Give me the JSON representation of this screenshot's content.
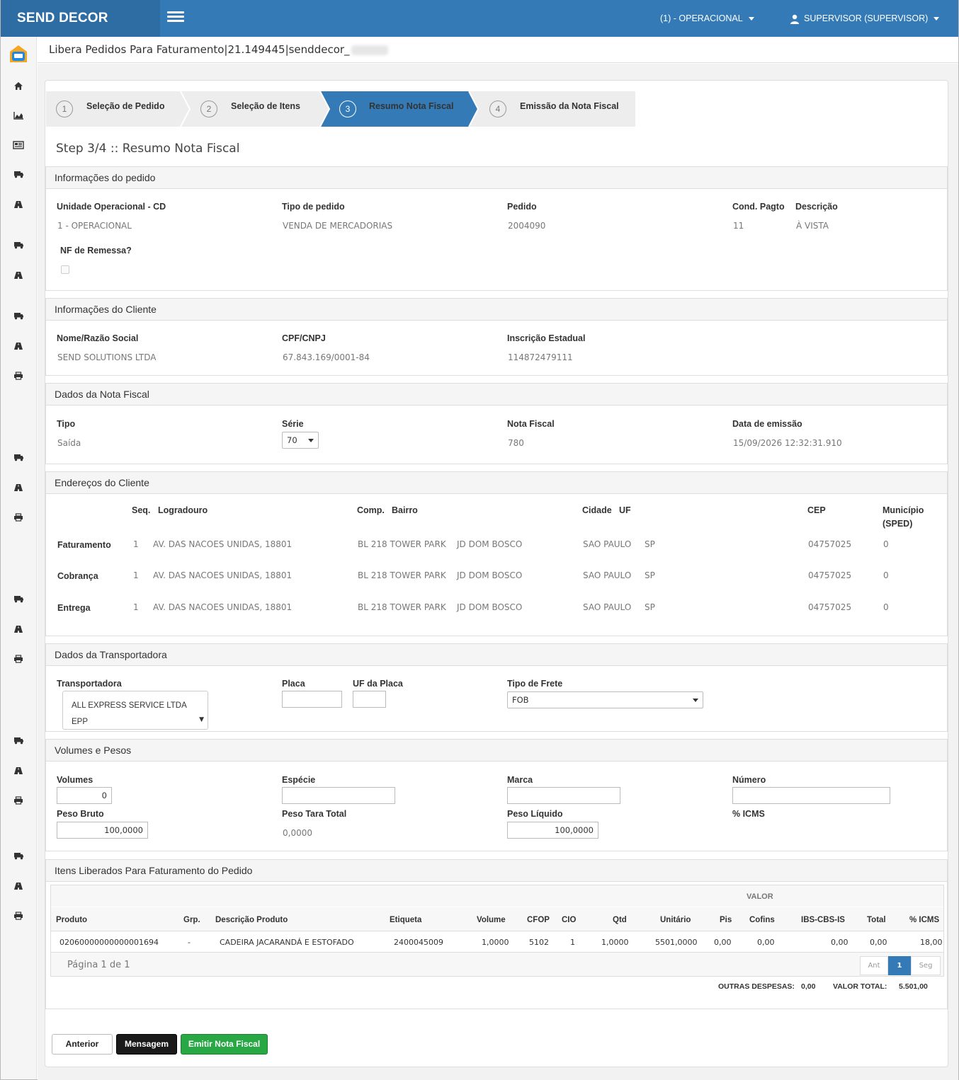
{
  "app": {
    "brand": "SEND DECOR"
  },
  "header": {
    "unit": "(1) - OPERACIONAL",
    "user": "SUPERVISOR (SUPERVISOR)"
  },
  "breadcrumb": "Libera Pedidos Para Faturamento|21.149445|senddecor_",
  "wizard": {
    "steps": [
      {
        "num": "1",
        "label": "Seleção de Pedido"
      },
      {
        "num": "2",
        "label": "Seleção de Itens"
      },
      {
        "num": "3",
        "label": "Resumo Nota Fiscal"
      },
      {
        "num": "4",
        "label": "Emissão da Nota Fiscal"
      }
    ],
    "active_step": 3,
    "active_color": "#337ab7"
  },
  "step_title": "Step 3/4 :: Resumo Nota Fiscal",
  "pedido": {
    "title": "Informações do pedido",
    "unidade_label": "Unidade Operacional - CD",
    "unidade_value": "1 - OPERACIONAL",
    "tipo_label": "Tipo de pedido",
    "tipo_value": "VENDA DE MERCADORIAS",
    "pedido_label": "Pedido",
    "pedido_value": "2004090",
    "cond_label": "Cond. Pagto",
    "cond_value": "11",
    "desc_label": "Descrição",
    "desc_value": "À VISTA",
    "remessa_label": "NF de Remessa?"
  },
  "cliente": {
    "title": "Informações do Cliente",
    "nome_label": "Nome/Razão Social",
    "nome_value": "SEND SOLUTIONS LTDA",
    "cpf_label": "CPF/CNPJ",
    "cpf_value": "67.843.169/0001-84",
    "ie_label": "Inscrição Estadual",
    "ie_value": "114872479111"
  },
  "nota": {
    "title": "Dados da Nota Fiscal",
    "tipo_label": "Tipo",
    "tipo_value": "Saída",
    "serie_label": "Série",
    "serie_value": "70",
    "nf_label": "Nota Fiscal",
    "nf_value": "780",
    "data_label": "Data de emissão",
    "data_value": "15/09/2026 12:32:31.910"
  },
  "enderecos": {
    "title": "Endereços do Cliente",
    "headers": {
      "seq": "Seq.",
      "logradouro": "Logradouro",
      "comp": "Comp.",
      "bairro": "Bairro",
      "cidade": "Cidade",
      "uf": "UF",
      "cep": "CEP",
      "municipio": "Município",
      "sped": "(SPED)"
    },
    "rows": [
      {
        "tipo": "Faturamento",
        "seq": "1",
        "logradouro": "AV. DAS NACOES UNIDAS, 18801",
        "comp": "BL 218 TOWER PARK",
        "bairro": "JD DOM BOSCO",
        "cidade": "SAO PAULO",
        "uf": "SP",
        "cep": "04757025",
        "municipio": "0"
      },
      {
        "tipo": "Cobrança",
        "seq": "1",
        "logradouro": "AV. DAS NACOES UNIDAS, 18801",
        "comp": "BL 218 TOWER PARK",
        "bairro": "JD DOM BOSCO",
        "cidade": "SAO PAULO",
        "uf": "SP",
        "cep": "04757025",
        "municipio": "0"
      },
      {
        "tipo": "Entrega",
        "seq": "1",
        "logradouro": "AV. DAS NACOES UNIDAS, 18801",
        "comp": "BL 218 TOWER PARK",
        "bairro": "JD DOM BOSCO",
        "cidade": "SAO PAULO",
        "uf": "SP",
        "cep": "04757025",
        "municipio": "0"
      }
    ]
  },
  "transportadora": {
    "title": "Dados da Transportadora",
    "transp_label": "Transportadora",
    "transp_value": "ALL EXPRESS SERVICE LTDA EPP",
    "placa_label": "Placa",
    "placa_value": "",
    "uf_label": "UF da Placa",
    "uf_value": "",
    "frete_label": "Tipo de Frete",
    "frete_value": "FOB"
  },
  "volumes": {
    "title": "Volumes e Pesos",
    "volumes_label": "Volumes",
    "volumes_value": "0",
    "especie_label": "Espécie",
    "especie_value": "",
    "marca_label": "Marca",
    "marca_value": "",
    "numero_label": "Número",
    "numero_value": "",
    "bruto_label": "Peso Bruto",
    "bruto_value": "100,0000",
    "tara_label": "Peso Tara Total",
    "tara_value": "0,0000",
    "liquido_label": "Peso Líquido",
    "liquido_value": "100,0000",
    "icms_label": "% ICMS"
  },
  "itens": {
    "title": "Itens Liberados Para Faturamento do Pedido",
    "valor_group": "VALOR",
    "headers": {
      "produto": "Produto",
      "grp": "Grp.",
      "descricao": "Descrição Produto",
      "etiqueta": "Etiqueta",
      "volume": "Volume",
      "cfop": "CFOP",
      "cio": "CIO",
      "qtd": "Qtd",
      "unitario": "Unitário",
      "pis": "Pis",
      "cofins": "Cofins",
      "ibs": "IBS-CBS-IS",
      "total": "Total",
      "icms": "% ICMS"
    },
    "rows": [
      {
        "produto": "02060000000000001694",
        "grp": "-",
        "descricao": "CADEIRA JACARANDÁ E ESTOFADO",
        "etiqueta": "2400045009",
        "volume": "1,0000",
        "cfop": "5102",
        "cio": "1",
        "qtd": "1,0000",
        "unitario": "5501,0000",
        "pis": "0,00",
        "cofins": "0,00",
        "ibs": "0,00",
        "total": "0,00",
        "icms": "18,00"
      }
    ],
    "pagination": {
      "info": "Página 1 de 1",
      "prev": "Ant",
      "current": "1",
      "next": "Seg"
    },
    "outras_label": "OUTRAS DESPESAS:",
    "outras_value": "0,00",
    "total_label": "VALOR TOTAL:",
    "total_value": "5.501,00"
  },
  "actions": {
    "anterior": "Anterior",
    "mensagem": "Mensagem",
    "emitir": "Emitir Nota Fiscal"
  },
  "colors": {
    "primary": "#337ab7",
    "success": "#28a745",
    "dark": "#1a1a1a"
  }
}
